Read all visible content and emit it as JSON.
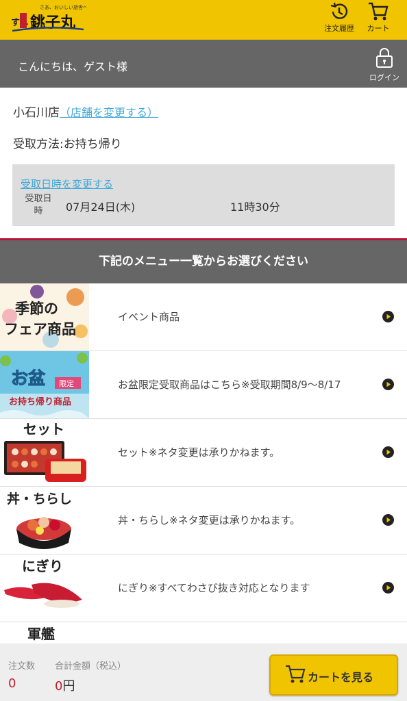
{
  "header": {
    "logo_tagline": "さあ、おいしい旅舎へ",
    "logo_brand": "銚子丸",
    "logo_prefix": "すし",
    "history_label": "注文履歴",
    "cart_label": "カート"
  },
  "guest": {
    "greeting": "こんにちは、ゲスト様",
    "login_label": "ログイン"
  },
  "store": {
    "name": "小石川店",
    "change_link": "（店舗を変更する）"
  },
  "pickup": {
    "method": "受取方法:お持ち帰り",
    "change_datetime": "受取日時を変更する",
    "datetime_label": "受取日時",
    "date": "07月24日(木)",
    "time": "11時30分"
  },
  "menu": {
    "heading": "下記のメニュー一覧からお選びください",
    "items": [
      {
        "image_text": "季節のフェア商品",
        "label": "イベント商品"
      },
      {
        "image_text": "お盆 限定 お持ち帰り商品",
        "label": "お盆限定受取商品はこちら※受取期間8/9〜8/17"
      },
      {
        "image_text": "セット",
        "label": "セット※ネタ変更は承りかねます。"
      },
      {
        "image_text": "丼・ちらし",
        "label": "丼・ちらし※ネタ変更は承りかねます。"
      },
      {
        "image_text": "にぎり",
        "label": "にぎり※すべてわさび抜き対応となります"
      },
      {
        "image_text": "軍艦",
        "label": ""
      }
    ]
  },
  "footer": {
    "order_count_label": "注文数",
    "order_count": "0",
    "total_label": "合計金額（税込）",
    "total_value": "0",
    "total_unit": "円",
    "cart_button": "カートを見る"
  },
  "colors": {
    "header_yellow": "#f0c500",
    "gray_bar": "#666666",
    "accent_red": "#b8143a",
    "link_blue": "#3ea8d8"
  }
}
